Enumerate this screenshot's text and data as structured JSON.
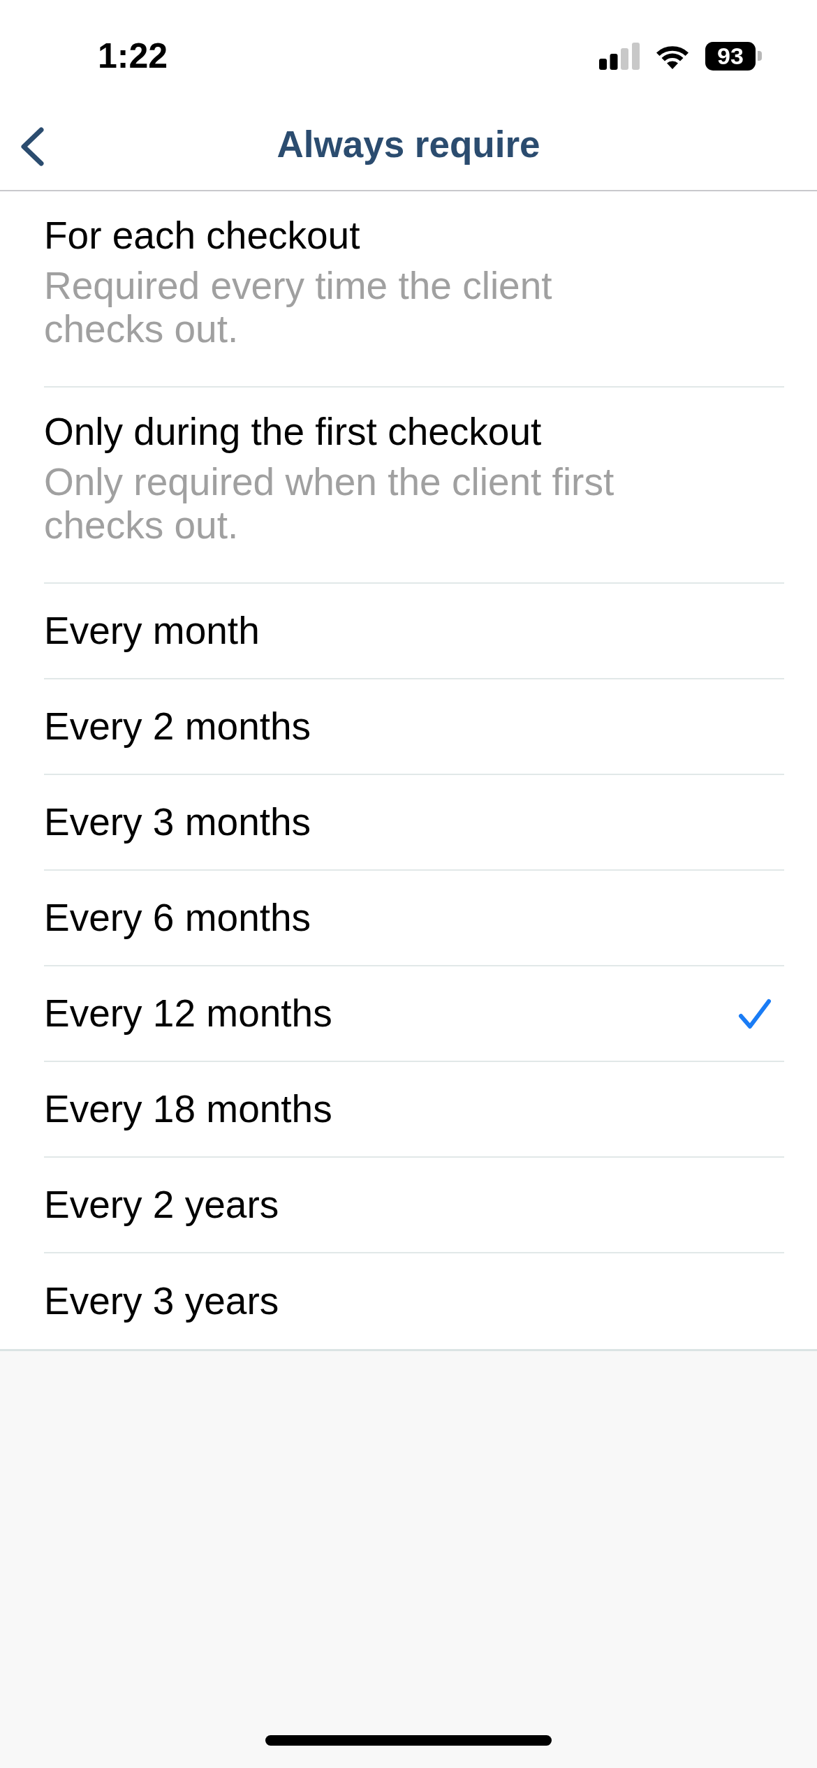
{
  "status_bar": {
    "time": "1:22",
    "battery": "93"
  },
  "nav_bar": {
    "title": "Always require"
  },
  "options": [
    {
      "title": "For each checkout",
      "subtitle": "Required every time the client checks out.",
      "selected": false
    },
    {
      "title": "Only during the first checkout",
      "subtitle": "Only required when the client first checks out.",
      "selected": false
    },
    {
      "title": "Every month",
      "selected": false
    },
    {
      "title": "Every 2 months",
      "selected": false
    },
    {
      "title": "Every 3 months",
      "selected": false
    },
    {
      "title": "Every 6 months",
      "selected": false
    },
    {
      "title": "Every 12 months",
      "selected": true
    },
    {
      "title": "Every 18 months",
      "selected": false
    },
    {
      "title": "Every 2 years",
      "selected": false
    },
    {
      "title": "Every 3 years",
      "selected": false
    }
  ]
}
